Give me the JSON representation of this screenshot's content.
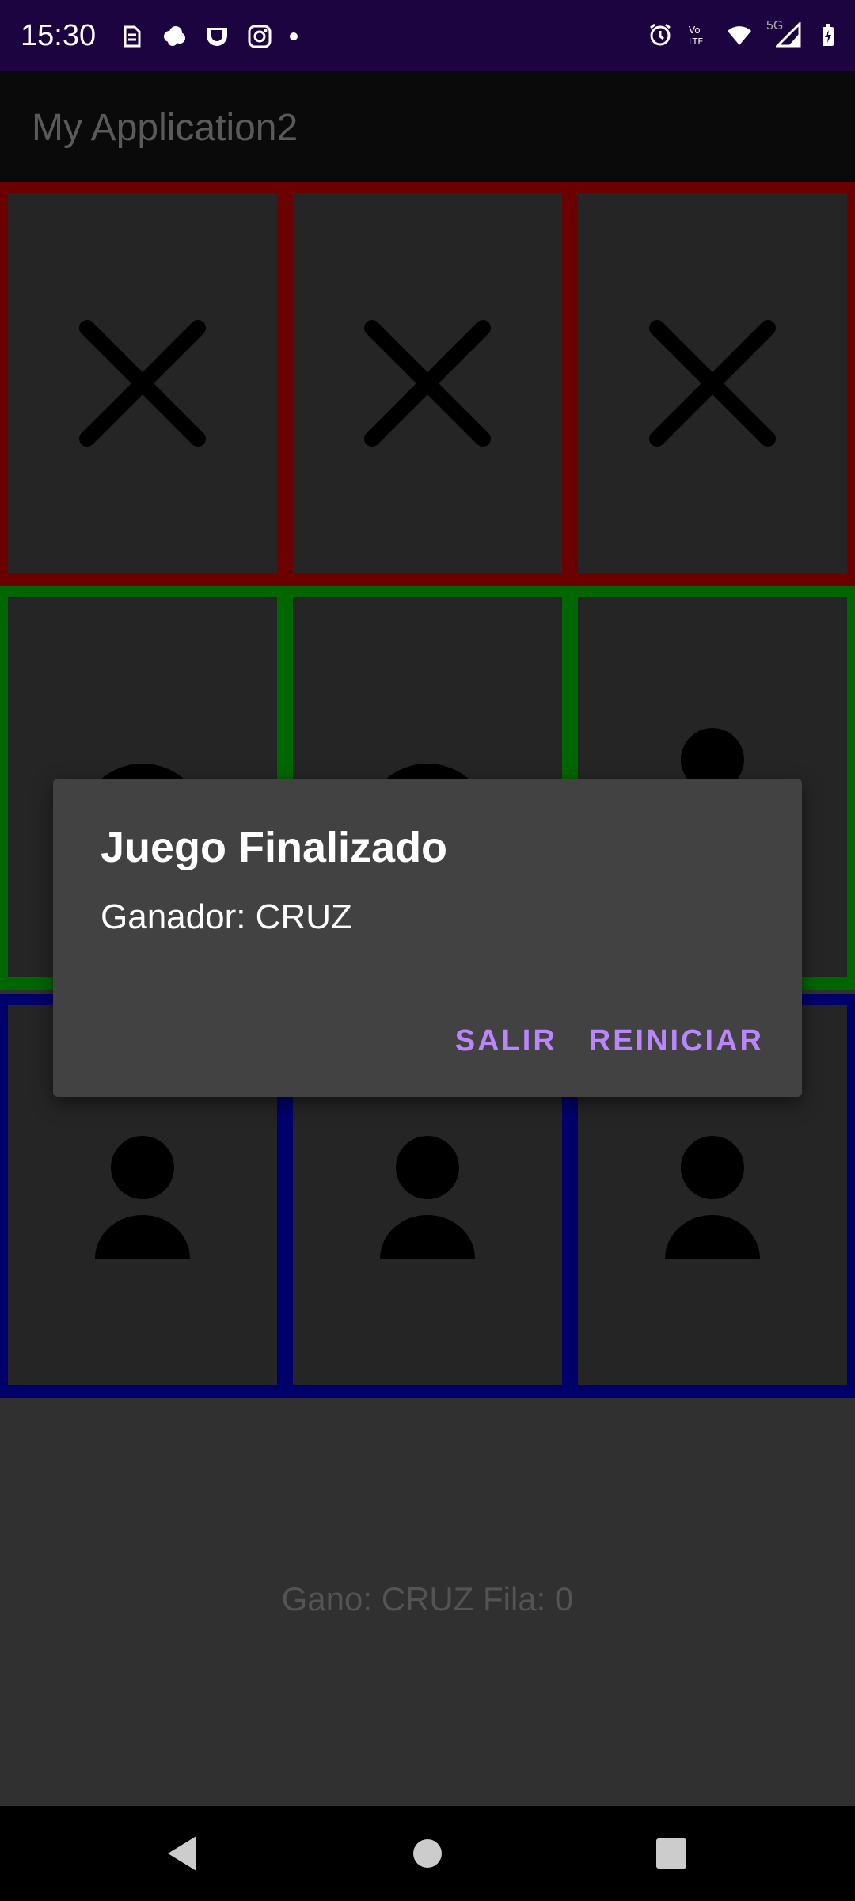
{
  "status_bar": {
    "time": "15:30",
    "left_icons": [
      "sim-icon",
      "cloud-icon",
      "cup-icon",
      "instagram-icon"
    ],
    "right_icons": [
      "alarm-icon",
      "volte-icon",
      "wifi-icon",
      "signal-icon",
      "battery-icon"
    ],
    "network": "5G"
  },
  "app_bar": {
    "title": "My Application2"
  },
  "board": {
    "rows": [
      {
        "color": "#6b0000",
        "cells": [
          "X",
          "X",
          "X"
        ]
      },
      {
        "color": "#006600",
        "cells": [
          "O",
          "O",
          "player"
        ]
      },
      {
        "color": "#00006b",
        "cells": [
          "player",
          "player",
          "player"
        ]
      }
    ]
  },
  "result": {
    "text": "Gano: CRUZ Fila: 0"
  },
  "dialog": {
    "title": "Juego Finalizado",
    "message": "Ganador: CRUZ",
    "buttons": {
      "exit": "SALIR",
      "restart": "REINICIAR"
    },
    "accent_color": "#bb86fc"
  },
  "nav_bar": {
    "icons": [
      "back-icon",
      "home-icon",
      "recents-icon"
    ]
  }
}
